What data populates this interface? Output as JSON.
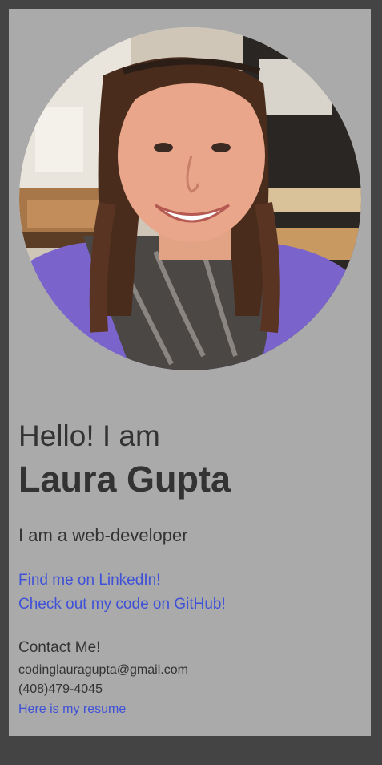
{
  "profile": {
    "photo_alt": "Laura Gupta profile photo",
    "greeting": "Hello! I am",
    "name": "Laura Gupta",
    "tagline": "I am a web-developer"
  },
  "links": {
    "linkedin": "Find me on LinkedIn!",
    "github": "Check out my code on GitHub!"
  },
  "contact": {
    "heading": "Contact Me!",
    "email": "codinglauragupta@gmail.com",
    "phone": "(408)479-4045",
    "resume": "Here is my resume"
  },
  "colors": {
    "page_background": "#444444",
    "card_background": "#aaaaaa",
    "text": "#333333",
    "link": "#3f51d6"
  }
}
